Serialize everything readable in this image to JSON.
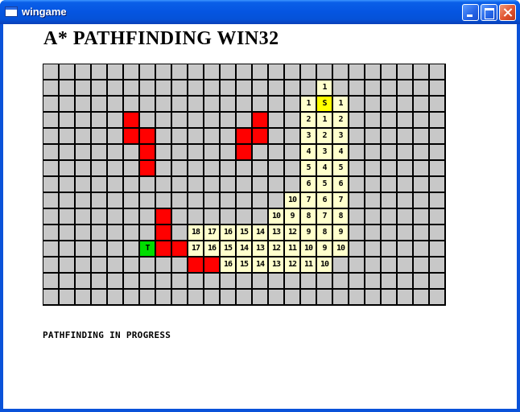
{
  "window": {
    "title": "wingame",
    "icon": "window-app-icon",
    "buttons": [
      "minimize-icon",
      "maximize-icon",
      "close-icon"
    ]
  },
  "heading": "A* PATHFINDING WIN32",
  "status": "PATHFINDING IN PROGRESS",
  "grid": {
    "cols": 25,
    "rows": 15,
    "colors": {
      "empty": "#c8c8c8",
      "open": "#ffffcc",
      "wall": "#ff0000",
      "start": "#ffff00",
      "target": "#00dd00"
    },
    "start": {
      "r": 2,
      "c": 17,
      "label": "S"
    },
    "target": {
      "r": 11,
      "c": 6,
      "label": "T"
    },
    "walls": [
      [
        3,
        5
      ],
      [
        3,
        13
      ],
      [
        4,
        5
      ],
      [
        4,
        6
      ],
      [
        4,
        12
      ],
      [
        4,
        13
      ],
      [
        5,
        6
      ],
      [
        5,
        12
      ],
      [
        6,
        6
      ],
      [
        9,
        7
      ],
      [
        10,
        7
      ],
      [
        11,
        7
      ],
      [
        11,
        8
      ],
      [
        12,
        9
      ],
      [
        12,
        10
      ]
    ],
    "values": [
      [
        1,
        17,
        "1"
      ],
      [
        2,
        16,
        "1"
      ],
      [
        2,
        18,
        "1"
      ],
      [
        3,
        16,
        "2"
      ],
      [
        3,
        17,
        "1"
      ],
      [
        3,
        18,
        "2"
      ],
      [
        4,
        16,
        "3"
      ],
      [
        4,
        17,
        "2"
      ],
      [
        4,
        18,
        "3"
      ],
      [
        5,
        16,
        "4"
      ],
      [
        5,
        17,
        "3"
      ],
      [
        5,
        18,
        "4"
      ],
      [
        6,
        16,
        "5"
      ],
      [
        6,
        17,
        "4"
      ],
      [
        6,
        18,
        "5"
      ],
      [
        7,
        16,
        "6"
      ],
      [
        7,
        17,
        "5"
      ],
      [
        7,
        18,
        "6"
      ],
      [
        8,
        15,
        "10"
      ],
      [
        8,
        16,
        "7"
      ],
      [
        8,
        17,
        "6"
      ],
      [
        8,
        18,
        "7"
      ],
      [
        9,
        14,
        "10"
      ],
      [
        9,
        15,
        "9"
      ],
      [
        9,
        16,
        "8"
      ],
      [
        9,
        17,
        "7"
      ],
      [
        9,
        18,
        "8"
      ],
      [
        10,
        9,
        "18"
      ],
      [
        10,
        10,
        "17"
      ],
      [
        10,
        11,
        "16"
      ],
      [
        10,
        12,
        "15"
      ],
      [
        10,
        13,
        "14"
      ],
      [
        10,
        14,
        "13"
      ],
      [
        10,
        15,
        "12"
      ],
      [
        10,
        16,
        "9"
      ],
      [
        10,
        17,
        "8"
      ],
      [
        10,
        18,
        "9"
      ],
      [
        11,
        9,
        "17"
      ],
      [
        11,
        10,
        "16"
      ],
      [
        11,
        11,
        "15"
      ],
      [
        11,
        12,
        "14"
      ],
      [
        11,
        13,
        "13"
      ],
      [
        11,
        14,
        "12"
      ],
      [
        11,
        15,
        "11"
      ],
      [
        11,
        16,
        "10"
      ],
      [
        11,
        17,
        "9"
      ],
      [
        11,
        18,
        "10"
      ],
      [
        12,
        11,
        "16"
      ],
      [
        12,
        12,
        "15"
      ],
      [
        12,
        13,
        "14"
      ],
      [
        12,
        14,
        "13"
      ],
      [
        12,
        15,
        "12"
      ],
      [
        12,
        16,
        "11"
      ],
      [
        12,
        17,
        "10"
      ]
    ]
  }
}
